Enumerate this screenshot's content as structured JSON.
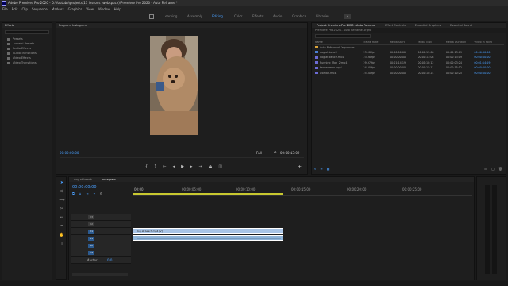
{
  "app": {
    "title": "Adobe Premiere Pro 2020 - D:\\Youtube\\projects\\13 lessons (webspace)\\Premiere Pro 2020 - Auto Reframe *"
  },
  "menu": [
    "File",
    "Edit",
    "Clip",
    "Sequence",
    "Markers",
    "Graphics",
    "View",
    "Window",
    "Help"
  ],
  "workspaces": [
    "Learning",
    "Assembly",
    "Editing",
    "Color",
    "Effects",
    "Audio",
    "Graphics",
    "Libraries"
  ],
  "active_workspace": "Editing",
  "effects_panel": {
    "title": "Effects",
    "items": [
      "Presets",
      "Lumetri Presets",
      "Audio Effects",
      "Audio Transitions",
      "Video Effects",
      "Video Transitions"
    ]
  },
  "program": {
    "title": "Program: Instagram",
    "timecode_left": "00:00:00:00",
    "timecode_right": "00:00:13:09",
    "fit": "Full"
  },
  "project": {
    "tabs": [
      "Project: Premiere Pro 2020 - Auto Reframe",
      "Effect Controls",
      "Essential Graphics",
      "Essential Sound"
    ],
    "path": "Premiere Pro 2020 - Auto Reframe.prproj",
    "columns": [
      "Name",
      "Frame Rate",
      "Media Start",
      "Media End",
      "Media Duration",
      "Video In Point"
    ],
    "rows": [
      {
        "name": "Auto Reframed Sequences",
        "swatch": "#d9a33a",
        "frame_rate": "",
        "start": "",
        "end": "",
        "duration": "",
        "in": ""
      },
      {
        "name": "dog at beach",
        "swatch": "#4a7fd4",
        "frame_rate": "23.98 fps",
        "start": "00:00:00:00",
        "end": "00:00:13:08",
        "duration": "00:00:13:09",
        "in": "00:00:00:00"
      },
      {
        "name": "dog at beach.mp4",
        "swatch": "#6b6bd4",
        "frame_rate": "23.98 fps",
        "start": "00:00:00:00",
        "end": "00:00:13:08",
        "duration": "00:00:13:09",
        "in": "00:00:00:00"
      },
      {
        "name": "Running_Man_2.mp4",
        "swatch": "#6b6bd4",
        "frame_rate": "29.97 fps",
        "start": "00:01:14:19",
        "end": "00:01:18:12",
        "duration": "00:00:03:24",
        "in": "00:01:14:19"
      },
      {
        "name": "two-women.mp4",
        "swatch": "#6b6bd4",
        "frame_rate": "24.00 fps",
        "start": "00:00:00:00",
        "end": "00:00:15:11",
        "duration": "00:00:15:12",
        "in": "00:00:00:00"
      },
      {
        "name": "woman.mp4",
        "swatch": "#6b6bd4",
        "frame_rate": "25.00 fps",
        "start": "00:00:00:00",
        "end": "00:00:10:24",
        "duration": "00:00:10:25",
        "in": "00:00:00:00"
      }
    ]
  },
  "timeline": {
    "tabs": [
      "dog at beach",
      "Instagram"
    ],
    "active_tab": "Instagram",
    "timecode": "00:00:00:00",
    "ruler": [
      "00:00",
      "00:00:05:00",
      "00:00:10:00",
      "00:00:15:00",
      "00:00:20:00",
      "00:00:25:00"
    ],
    "tracks": [
      "V3",
      "V2",
      "V1",
      "A1",
      "A2",
      "A3"
    ],
    "master_label": "Master",
    "master_value": "0.0",
    "video_clip": "dog at beach.mp4 [V]"
  },
  "colors": {
    "accent": "#4aa0ff",
    "video_clip": "#a8c4e6",
    "audio_clip": "#8fb4d8"
  }
}
